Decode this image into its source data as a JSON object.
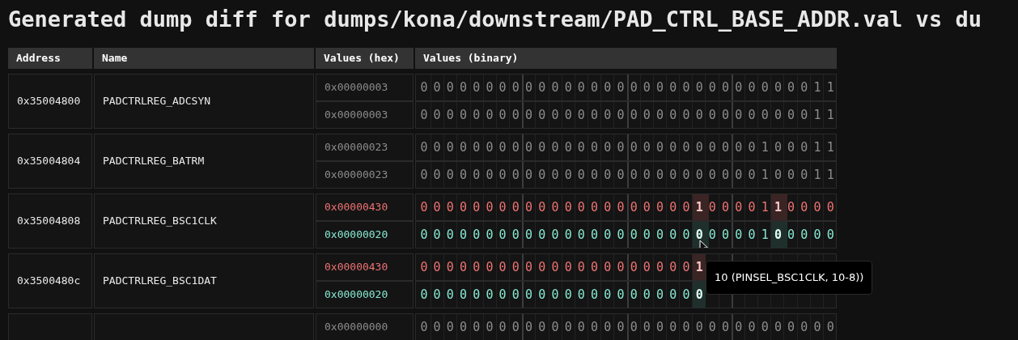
{
  "title": "Generated dump diff for dumps/kona/downstream/PAD_CTRL_BASE_ADDR.val vs du",
  "table": {
    "columns": [
      "Address",
      "Name",
      "Values (hex)",
      "Values (binary)"
    ],
    "rows": [
      {
        "address": "0x35004800",
        "name": "PADCTRLREG_ADCSYN",
        "values": [
          {
            "kind": "same",
            "hex": "0x00000003",
            "bits": "00000000000000000000000000000011"
          },
          {
            "kind": "same",
            "hex": "0x00000003",
            "bits": "00000000000000000000000000000011"
          }
        ]
      },
      {
        "address": "0x35004804",
        "name": "PADCTRLREG_BATRM",
        "values": [
          {
            "kind": "same",
            "hex": "0x00000023",
            "bits": "00000000000000000000000000100011"
          },
          {
            "kind": "same",
            "hex": "0x00000023",
            "bits": "00000000000000000000000000100011"
          }
        ]
      },
      {
        "address": "0x35004808",
        "name": "PADCTRLREG_BSC1CLK",
        "values": [
          {
            "kind": "old",
            "hex": "0x00000430",
            "bits": "00000000000000000000010000110000"
          },
          {
            "kind": "new",
            "hex": "0x00000020",
            "bits": "00000000000000000000000000100000"
          }
        ]
      },
      {
        "address": "0x3500480c",
        "name": "PADCTRLREG_BSC1DAT",
        "values": [
          {
            "kind": "old",
            "hex": "0x00000430",
            "bits": "0000000000000000000001"
          },
          {
            "kind": "new",
            "hex": "0x00000020",
            "bits": "0000000000000000000000"
          }
        ]
      },
      {
        "values": [
          {
            "kind": "same",
            "hex": "0x00000000",
            "bits": "00000000000000000000000000000000"
          }
        ]
      }
    ]
  },
  "tooltip": {
    "text": "10 (PINSEL_BSC1CLK, 10-8))"
  }
}
